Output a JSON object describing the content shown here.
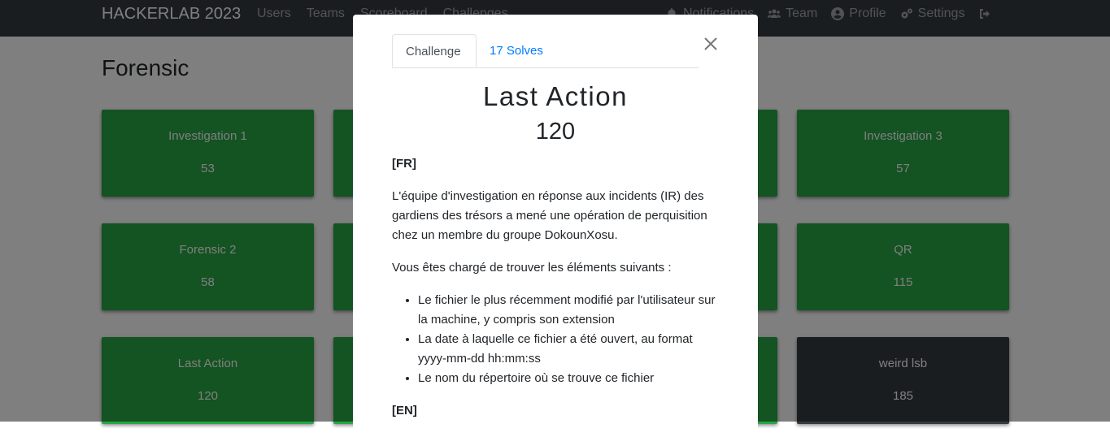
{
  "navbar": {
    "brand": "HACKERLAB 2023",
    "links": [
      "Users",
      "Teams",
      "Scoreboard",
      "Challenges"
    ],
    "right": {
      "notifications": "Notifications",
      "team": "Team",
      "profile": "Profile",
      "settings": "Settings"
    }
  },
  "page": {
    "category_title": "Forensic",
    "cards": [
      {
        "name": "Investigation 1",
        "value": "53"
      },
      {
        "name": "Investigation 3",
        "value": "57"
      },
      {
        "name": "Forensic 2",
        "value": "58"
      },
      {
        "name": "QR",
        "value": "115"
      },
      {
        "name": "Last Action",
        "value": "120"
      },
      {
        "name": "weird lsb",
        "value": "185"
      }
    ]
  },
  "modal": {
    "tabs": {
      "challenge": "Challenge",
      "solves": "17 Solves"
    },
    "title": "Last Action",
    "value": "120",
    "description": {
      "fr_tag": "[FR]",
      "p1": "L'équipe d'investigation en réponse aux incidents (IR) des gardiens des trésors a mené une opération de perquisition chez un membre du groupe DokounXosu.",
      "p2": "Vous êtes chargé de trouver les éléments suivants :",
      "items": [
        "Le fichier le plus récemment modifié par l'utilisateur sur la machine, y compris son extension",
        "La date à laquelle ce fichier a été ouvert, au format yyyy-mm-dd hh:mm:ss",
        "Le nom du répertoire où se trouve ce fichier"
      ],
      "en_tag": "[EN]"
    }
  },
  "colors": {
    "solved": "#28a745",
    "unsolved": "#343a40",
    "navbar": "#343a40",
    "link": "#007bff"
  }
}
